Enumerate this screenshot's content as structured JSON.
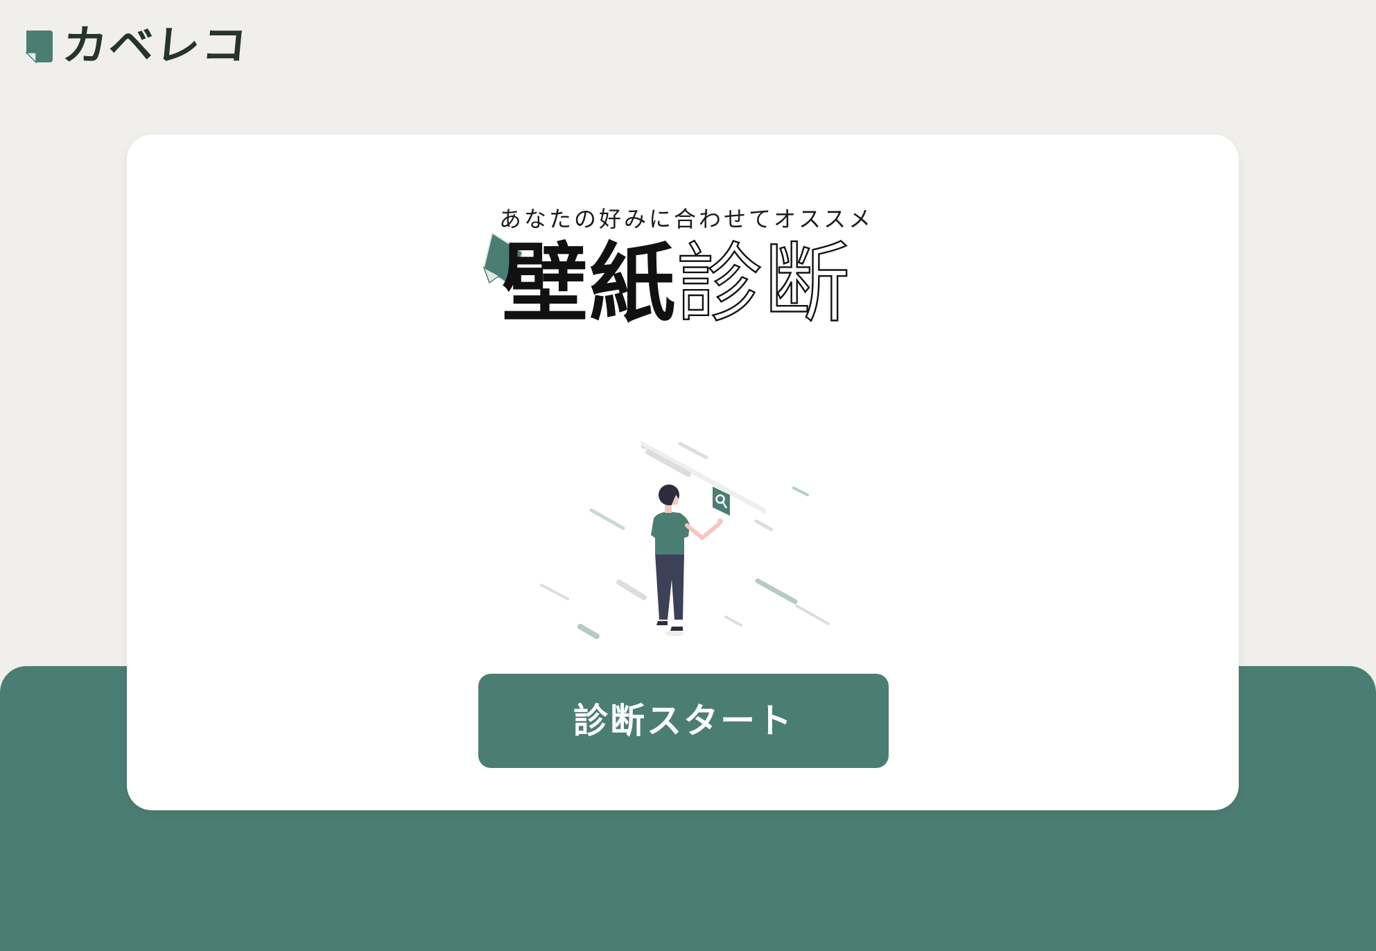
{
  "brand": {
    "name": "カベレコ",
    "logo_icon": "wallpaper-roll-icon",
    "logo_color": "#4b7e72"
  },
  "card": {
    "tagline": "あなたの好みに合わせてオススメ",
    "title_main": "壁紙",
    "title_accent": "診断",
    "title_icon": "wallpaper-roll-icon",
    "illustration": "woman-searching-wall-illustration"
  },
  "cta": {
    "label": "診断スタート"
  },
  "colors": {
    "page_background": "#f0efec",
    "accent": "#4b7e72",
    "card_background": "#ffffff",
    "text_dark": "#26332f"
  }
}
